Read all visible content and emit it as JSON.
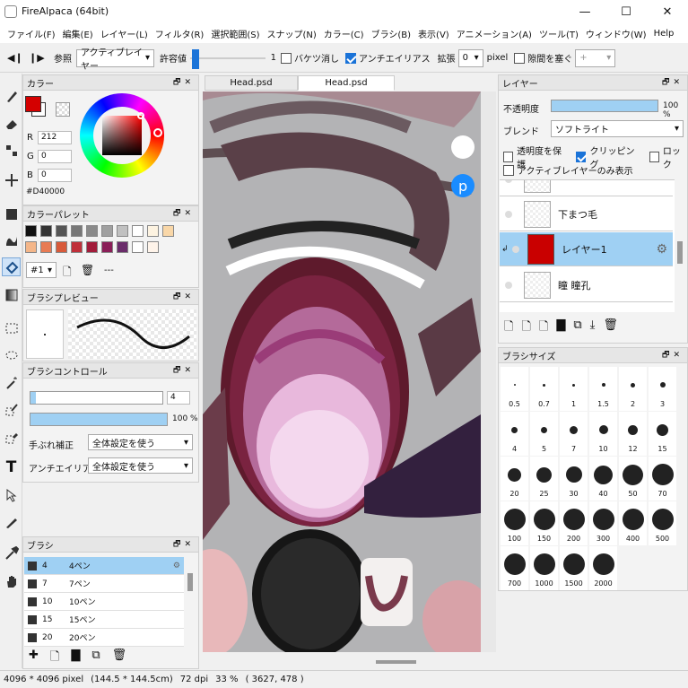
{
  "window": {
    "title": "FireAlpaca (64bit)",
    "minimize": "—",
    "maximize": "☐",
    "close": "✕"
  },
  "menu": [
    "ファイル(F)",
    "編集(E)",
    "レイヤー(L)",
    "フィルタ(R)",
    "選択範囲(S)",
    "スナップ(N)",
    "カラー(C)",
    "ブラシ(B)",
    "表示(V)",
    "アニメーション(A)",
    "ツール(T)",
    "ウィンドウ(W)",
    "Help"
  ],
  "toolbar": {
    "ref_label": "参照",
    "ref_value": "アクティブレイヤー",
    "tolerance_label": "許容値",
    "tolerance_value": "1",
    "bucket_label": "バケツ消し",
    "antialias_label": "アンチエイリアス",
    "expand_label": "拡張",
    "expand_value": "0",
    "unit": "pixel",
    "gap_label": "隙間を塞ぐ",
    "gap_value": "+",
    "tolerance_fraction": 0.02
  },
  "color_panel": {
    "title": "カラー",
    "r_label": "R",
    "r": "212",
    "g_label": "G",
    "g": "0",
    "b_label": "B",
    "b": "0",
    "hex": "#D40000",
    "primary": "#D40000"
  },
  "palette_panel": {
    "title": "カラーパレット",
    "index": "#1",
    "extra": "---",
    "swatches": [
      "#111111",
      "#333333",
      "#555555",
      "#777777",
      "#8a8a8a",
      "#a0a0a0",
      "#c0c0c0",
      "#ffffff",
      "#fdf3e1",
      "#f9d7a8",
      "#f4b689",
      "#e87b54",
      "#d85a3a",
      "#c0303a",
      "#a21c3a",
      "#8a1e58",
      "#6a2c6a",
      "#ffffff",
      "#fff4ea"
    ]
  },
  "brush_preview_panel": {
    "title": "ブラシプレビュー"
  },
  "brush_control_panel": {
    "title": "ブラシコントロール",
    "size": "4",
    "opacity": "100 %",
    "stab_label": "手ぶれ補正",
    "stab_value": "全体設定を使う",
    "aa_label": "アンチエイリアス",
    "aa_value": "全体設定を使う",
    "size_fraction": 0.04,
    "opacity_fraction": 1.0
  },
  "brush_panel": {
    "title": "ブラシ",
    "items": [
      {
        "size": "4",
        "name": "4ペン",
        "selected": true
      },
      {
        "size": "7",
        "name": "7ペン"
      },
      {
        "size": "10",
        "name": "10ペン"
      },
      {
        "size": "15",
        "name": "15ペン"
      },
      {
        "size": "20",
        "name": "20ペン"
      }
    ]
  },
  "tabs": [
    "Head.psd",
    "Head.psd"
  ],
  "layer_panel": {
    "title": "レイヤー",
    "opacity_label": "不透明度",
    "opacity_value": "100 %",
    "blend_label": "ブレンド",
    "blend_value": "ソフトライト",
    "protect_label": "透明度を保護",
    "clip_label": "クリッピング",
    "lock_label": "ロック",
    "active_only_label": "アクティブレイヤーのみ表示",
    "layers": [
      {
        "name": "下まつ毛"
      },
      {
        "name": "レイヤー1",
        "selected": true,
        "thumb": "#c90000"
      },
      {
        "name": "瞳 瞳孔"
      }
    ]
  },
  "brush_size_panel": {
    "title": "ブラシサイズ",
    "sizes": [
      "0.5",
      "0.7",
      "1",
      "1.5",
      "2",
      "3",
      "4",
      "5",
      "7",
      "10",
      "12",
      "15",
      "20",
      "25",
      "30",
      "40",
      "50",
      "70",
      "100",
      "150",
      "200",
      "300",
      "400",
      "500",
      "700",
      "1000",
      "1500",
      "2000"
    ]
  },
  "status": {
    "size": "4096 * 4096 pixel",
    "cm": "(144.5 * 144.5cm)",
    "dpi": "72 dpi",
    "zoom": "33 %",
    "cursor": "( 3627, 478 )"
  }
}
